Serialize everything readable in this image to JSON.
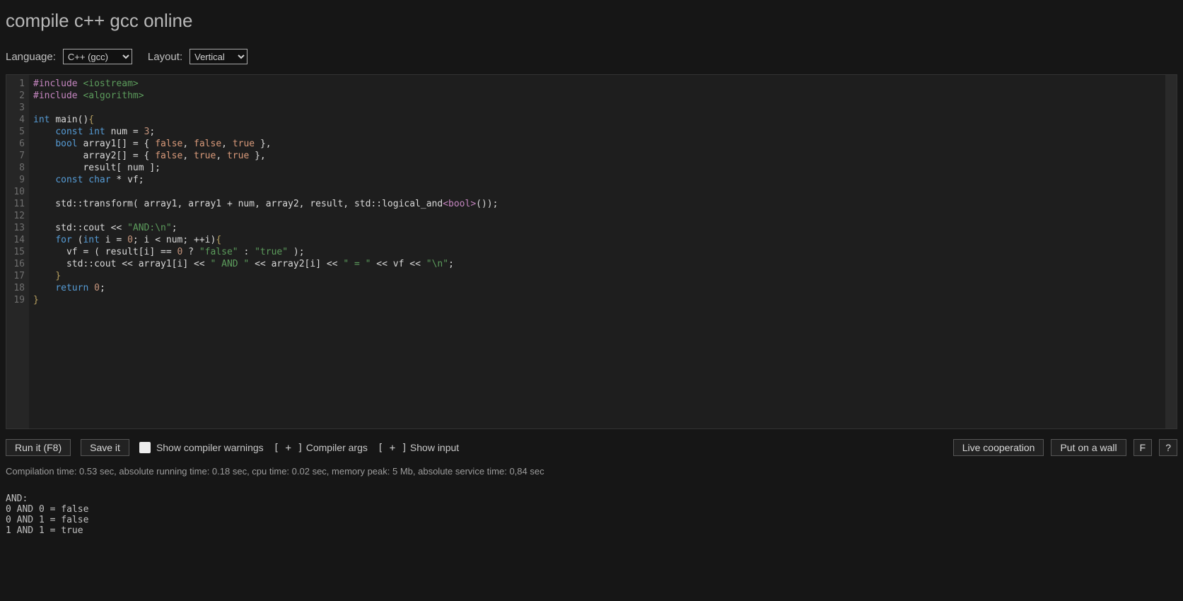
{
  "title": "compile c++ gcc online",
  "topbar": {
    "language_label": "Language:",
    "language_value": "C++ (gcc)",
    "layout_label": "Layout:",
    "layout_value": "Vertical"
  },
  "editor": {
    "line_count": 19,
    "code_lines": [
      {
        "n": 1,
        "html": "<span class='c-pre'>#include</span> <span class='c-str'>&lt;iostream&gt;</span>"
      },
      {
        "n": 2,
        "html": "<span class='c-pre'>#include</span> <span class='c-str'>&lt;algorithm&gt;</span>"
      },
      {
        "n": 3,
        "html": ""
      },
      {
        "n": 4,
        "html": "<span class='c-kw'>int</span> <span class='c-id'>main</span>()<span class='c-br'>{</span>"
      },
      {
        "n": 5,
        "html": "    <span class='c-kw'>const</span> <span class='c-kw'>int</span> num <span class='c-op'>=</span> <span class='c-num'>3</span>;"
      },
      {
        "n": 6,
        "html": "    <span class='c-kw'>bool</span> array1[] <span class='c-op'>=</span> { <span class='c-bool'>false</span>, <span class='c-bool'>false</span>, <span class='c-bool'>true</span> },"
      },
      {
        "n": 7,
        "html": "         array2[] <span class='c-op'>=</span> { <span class='c-bool'>false</span>, <span class='c-bool'>true</span>, <span class='c-bool'>true</span> },"
      },
      {
        "n": 8,
        "html": "         result[ num ];"
      },
      {
        "n": 9,
        "html": "    <span class='c-kw'>const</span> <span class='c-kw'>char</span> <span class='c-op'>*</span> vf;"
      },
      {
        "n": 10,
        "html": ""
      },
      {
        "n": 11,
        "html": "    std::transform( array1, array1 <span class='c-op'>+</span> num, array2, result, std::logical_and<span class='c-tmpl'>&lt;bool&gt;</span>());"
      },
      {
        "n": 12,
        "html": ""
      },
      {
        "n": 13,
        "html": "    std::cout <span class='c-op'>&lt;&lt;</span> <span class='c-str'>\"AND:\\n\"</span>;"
      },
      {
        "n": 14,
        "html": "    <span class='c-kw'>for</span> (<span class='c-kw'>int</span> i <span class='c-op'>=</span> <span class='c-num'>0</span>; i <span class='c-op'>&lt;</span> num; <span class='c-op'>++</span>i)<span class='c-br'>{</span>"
      },
      {
        "n": 15,
        "html": "      vf <span class='c-op'>=</span> ( result[i] <span class='c-op'>==</span> <span class='c-num'>0</span> <span class='c-op'>?</span> <span class='c-str'>\"false\"</span> <span class='c-op'>:</span> <span class='c-str'>\"true\"</span> );"
      },
      {
        "n": 16,
        "html": "      std::cout <span class='c-op'>&lt;&lt;</span> array1[i] <span class='c-op'>&lt;&lt;</span> <span class='c-str'>\" AND \"</span> <span class='c-op'>&lt;&lt;</span> array2[i] <span class='c-op'>&lt;&lt;</span> <span class='c-str'>\" = \"</span> <span class='c-op'>&lt;&lt;</span> vf <span class='c-op'>&lt;&lt;</span> <span class='c-str'>\"\\n\"</span>;"
      },
      {
        "n": 17,
        "html": "    <span class='c-br'>}</span>"
      },
      {
        "n": 18,
        "html": "    <span class='c-kw'>return</span> <span class='c-num'>0</span>;"
      },
      {
        "n": 19,
        "html": "<span class='c-br'>}</span>"
      }
    ]
  },
  "controls": {
    "run": "Run it (F8)",
    "save": "Save it",
    "show_warnings": "Show compiler warnings",
    "compiler_args_prefix": "[ + ]",
    "compiler_args": "Compiler args",
    "show_input_prefix": "[ + ]",
    "show_input": "Show input",
    "live_coop": "Live cooperation",
    "put_on_wall": "Put on a wall",
    "fullscreen": "F",
    "help": "?"
  },
  "status": "Compilation time: 0.53 sec, absolute running time: 0.18 sec, cpu time: 0.02 sec, memory peak: 5 Mb, absolute service time: 0,84 sec",
  "output": "AND:\n0 AND 0 = false\n0 AND 1 = false\n1 AND 1 = true"
}
